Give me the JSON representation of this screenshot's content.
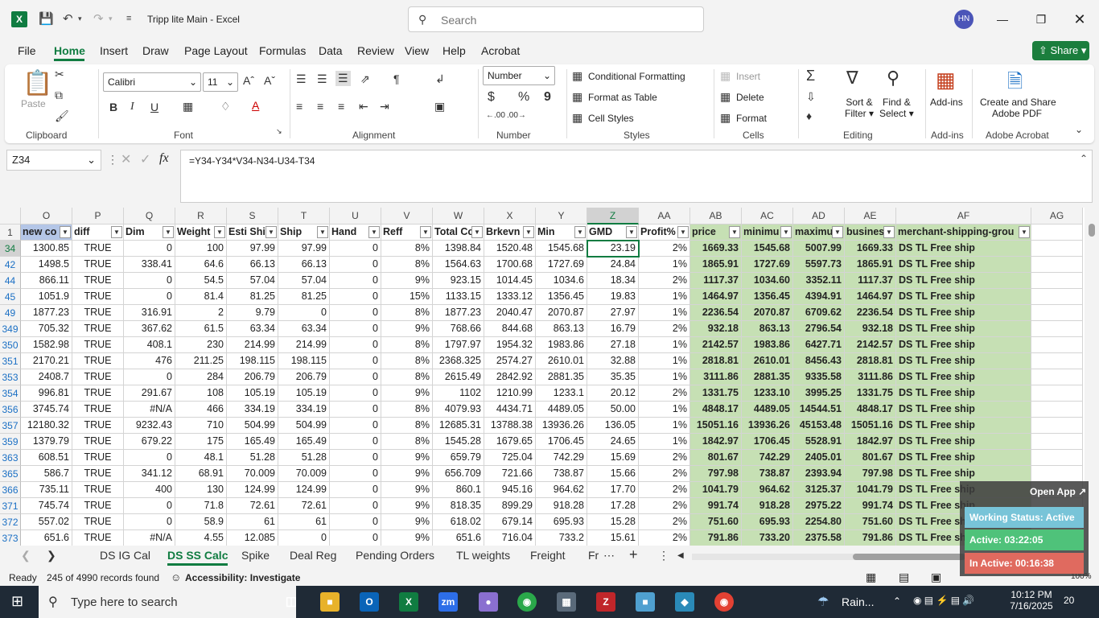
{
  "titlebar": {
    "title": "Tripp lite Main  -  Excel",
    "search_placeholder": "Search",
    "avatar": "HN",
    "app_icon": "X"
  },
  "menus": [
    "File",
    "Home",
    "Insert",
    "Draw",
    "Page Layout",
    "Formulas",
    "Data",
    "Review",
    "View",
    "Help",
    "Acrobat"
  ],
  "share_label": "Share",
  "ribbon": {
    "clipboard": {
      "paste": "Paste",
      "label": "Clipboard"
    },
    "font": {
      "name": "Calibri",
      "size": "11",
      "label": "Font",
      "bold": "B",
      "italic": "I",
      "underline": "U"
    },
    "alignment": {
      "label": "Alignment"
    },
    "number": {
      "format": "Number",
      "currency": "$",
      "percent": "%",
      "comma": "9",
      "label": "Number"
    },
    "styles": {
      "cond": "Conditional Formatting",
      "table": "Format as Table",
      "cell": "Cell Styles",
      "label": "Styles"
    },
    "cells": {
      "insert": "Insert",
      "delete": "Delete",
      "format": "Format",
      "label": "Cells"
    },
    "editing": {
      "sort1": "Sort &",
      "sort2": "Filter",
      "find1": "Find &",
      "find2": "Select",
      "label": "Editing"
    },
    "addins": {
      "btn": "Add-ins",
      "label": "Add-ins"
    },
    "acrobat": {
      "btn1": "Create and Share",
      "btn2": "Adobe PDF",
      "label": "Adobe Acrobat"
    }
  },
  "namebox": "Z34",
  "formula": "=Y34-Y34*V34-N34-U34-T34",
  "columns": [
    "O",
    "P",
    "Q",
    "R",
    "S",
    "T",
    "U",
    "V",
    "W",
    "X",
    "Y",
    "Z",
    "AA",
    "AB",
    "AC",
    "AD",
    "AE",
    "AF",
    "AG"
  ],
  "header_row": {
    "num": "1",
    "cells": [
      "new co",
      "diff",
      "Dim",
      "Weight",
      "Esti Shi",
      "Ship",
      "Hand",
      "Reff",
      "Total Co",
      "Brkevn",
      "Min",
      "GMD",
      "Profit%",
      "price",
      "minimu",
      "maximu",
      "busines",
      "merchant-shipping-grou"
    ]
  },
  "rows": [
    {
      "n": "34",
      "v": [
        "1300.85",
        "TRUE",
        "0",
        "100",
        "97.99",
        "97.99",
        "0",
        "8%",
        "1398.84",
        "1520.48",
        "1545.68",
        "23.19",
        "2%",
        "1669.33",
        "1545.68",
        "5007.99",
        "1669.33",
        "DS TL Free ship"
      ]
    },
    {
      "n": "42",
      "v": [
        "1498.5",
        "TRUE",
        "338.41",
        "64.6",
        "66.13",
        "66.13",
        "0",
        "8%",
        "1564.63",
        "1700.68",
        "1727.69",
        "24.84",
        "1%",
        "1865.91",
        "1727.69",
        "5597.73",
        "1865.91",
        "DS TL Free ship"
      ]
    },
    {
      "n": "44",
      "v": [
        "866.11",
        "TRUE",
        "0",
        "54.5",
        "57.04",
        "57.04",
        "0",
        "9%",
        "923.15",
        "1014.45",
        "1034.6",
        "18.34",
        "2%",
        "1117.37",
        "1034.60",
        "3352.11",
        "1117.37",
        "DS TL Free ship"
      ]
    },
    {
      "n": "45",
      "v": [
        "1051.9",
        "TRUE",
        "0",
        "81.4",
        "81.25",
        "81.25",
        "0",
        "15%",
        "1133.15",
        "1333.12",
        "1356.45",
        "19.83",
        "1%",
        "1464.97",
        "1356.45",
        "4394.91",
        "1464.97",
        "DS TL Free ship"
      ]
    },
    {
      "n": "49",
      "v": [
        "1877.23",
        "TRUE",
        "316.91",
        "2",
        "9.79",
        "0",
        "0",
        "8%",
        "1877.23",
        "2040.47",
        "2070.87",
        "27.97",
        "1%",
        "2236.54",
        "2070.87",
        "6709.62",
        "2236.54",
        "DS TL Free ship"
      ]
    },
    {
      "n": "349",
      "v": [
        "705.32",
        "TRUE",
        "367.62",
        "61.5",
        "63.34",
        "63.34",
        "0",
        "9%",
        "768.66",
        "844.68",
        "863.13",
        "16.79",
        "2%",
        "932.18",
        "863.13",
        "2796.54",
        "932.18",
        "DS TL Free ship"
      ]
    },
    {
      "n": "350",
      "v": [
        "1582.98",
        "TRUE",
        "408.1",
        "230",
        "214.99",
        "214.99",
        "0",
        "8%",
        "1797.97",
        "1954.32",
        "1983.86",
        "27.18",
        "1%",
        "2142.57",
        "1983.86",
        "6427.71",
        "2142.57",
        "DS TL Free ship"
      ]
    },
    {
      "n": "351",
      "v": [
        "2170.21",
        "TRUE",
        "476",
        "211.25",
        "198.115",
        "198.115",
        "0",
        "8%",
        "2368.325",
        "2574.27",
        "2610.01",
        "32.88",
        "1%",
        "2818.81",
        "2610.01",
        "8456.43",
        "2818.81",
        "DS TL Free ship"
      ]
    },
    {
      "n": "353",
      "v": [
        "2408.7",
        "TRUE",
        "0",
        "284",
        "206.79",
        "206.79",
        "0",
        "8%",
        "2615.49",
        "2842.92",
        "2881.35",
        "35.35",
        "1%",
        "3111.86",
        "2881.35",
        "9335.58",
        "3111.86",
        "DS TL Free ship"
      ]
    },
    {
      "n": "354",
      "v": [
        "996.81",
        "TRUE",
        "291.67",
        "108",
        "105.19",
        "105.19",
        "0",
        "9%",
        "1102",
        "1210.99",
        "1233.1",
        "20.12",
        "2%",
        "1331.75",
        "1233.10",
        "3995.25",
        "1331.75",
        "DS TL Free ship"
      ]
    },
    {
      "n": "356",
      "v": [
        "3745.74",
        "TRUE",
        "#N/A",
        "466",
        "334.19",
        "334.19",
        "0",
        "8%",
        "4079.93",
        "4434.71",
        "4489.05",
        "50.00",
        "1%",
        "4848.17",
        "4489.05",
        "14544.51",
        "4848.17",
        "DS TL Free ship"
      ]
    },
    {
      "n": "357",
      "v": [
        "12180.32",
        "TRUE",
        "9232.43",
        "710",
        "504.99",
        "504.99",
        "0",
        "8%",
        "12685.31",
        "13788.38",
        "13936.26",
        "136.05",
        "1%",
        "15051.16",
        "13936.26",
        "45153.48",
        "15051.16",
        "DS TL Free ship"
      ]
    },
    {
      "n": "359",
      "v": [
        "1379.79",
        "TRUE",
        "679.22",
        "175",
        "165.49",
        "165.49",
        "0",
        "8%",
        "1545.28",
        "1679.65",
        "1706.45",
        "24.65",
        "1%",
        "1842.97",
        "1706.45",
        "5528.91",
        "1842.97",
        "DS TL Free ship"
      ]
    },
    {
      "n": "363",
      "v": [
        "608.51",
        "TRUE",
        "0",
        "48.1",
        "51.28",
        "51.28",
        "0",
        "9%",
        "659.79",
        "725.04",
        "742.29",
        "15.69",
        "2%",
        "801.67",
        "742.29",
        "2405.01",
        "801.67",
        "DS TL Free ship"
      ]
    },
    {
      "n": "365",
      "v": [
        "586.7",
        "TRUE",
        "341.12",
        "68.91",
        "70.009",
        "70.009",
        "0",
        "9%",
        "656.709",
        "721.66",
        "738.87",
        "15.66",
        "2%",
        "797.98",
        "738.87",
        "2393.94",
        "797.98",
        "DS TL Free ship"
      ]
    },
    {
      "n": "366",
      "v": [
        "735.11",
        "TRUE",
        "400",
        "130",
        "124.99",
        "124.99",
        "0",
        "9%",
        "860.1",
        "945.16",
        "964.62",
        "17.70",
        "2%",
        "1041.79",
        "964.62",
        "3125.37",
        "1041.79",
        "DS TL Free ship"
      ]
    },
    {
      "n": "371",
      "v": [
        "745.74",
        "TRUE",
        "0",
        "71.8",
        "72.61",
        "72.61",
        "0",
        "9%",
        "818.35",
        "899.29",
        "918.28",
        "17.28",
        "2%",
        "991.74",
        "918.28",
        "2975.22",
        "991.74",
        "DS TL Free ship"
      ]
    },
    {
      "n": "372",
      "v": [
        "557.02",
        "TRUE",
        "0",
        "58.9",
        "61",
        "61",
        "0",
        "9%",
        "618.02",
        "679.14",
        "695.93",
        "15.28",
        "2%",
        "751.60",
        "695.93",
        "2254.80",
        "751.60",
        "DS TL Free ship"
      ]
    },
    {
      "n": "373",
      "v": [
        "651.6",
        "TRUE",
        "#N/A",
        "4.55",
        "12.085",
        "0",
        "0",
        "9%",
        "651.6",
        "716.04",
        "733.2",
        "15.61",
        "2%",
        "791.86",
        "733.20",
        "2375.58",
        "791.86",
        "DS TL Free ship"
      ]
    }
  ],
  "sheets": [
    "DS IG Cal",
    "DS SS Calc",
    "Spike",
    "Deal Reg",
    "Pending Orders",
    "TL weights",
    "Freight",
    "Fr"
  ],
  "active_sheet_index": 1,
  "status": {
    "ready": "Ready",
    "records": "245 of 4990 records found",
    "accessibility": "Accessibility: Investigate",
    "zoom": "100%"
  },
  "widget": {
    "open_app": "Open App ↗",
    "working": "Working Status: Active",
    "active": "Active: 03:22:05",
    "inactive": "In Active: 00:16:38"
  },
  "taskbar": {
    "search_placeholder": "Type here to search",
    "weather": "Rain...",
    "time": "10:12 PM",
    "date": "7/16/2025",
    "notif": "20"
  },
  "colors": {
    "accent": "#107c41",
    "highlight": "#c6e0b4"
  }
}
